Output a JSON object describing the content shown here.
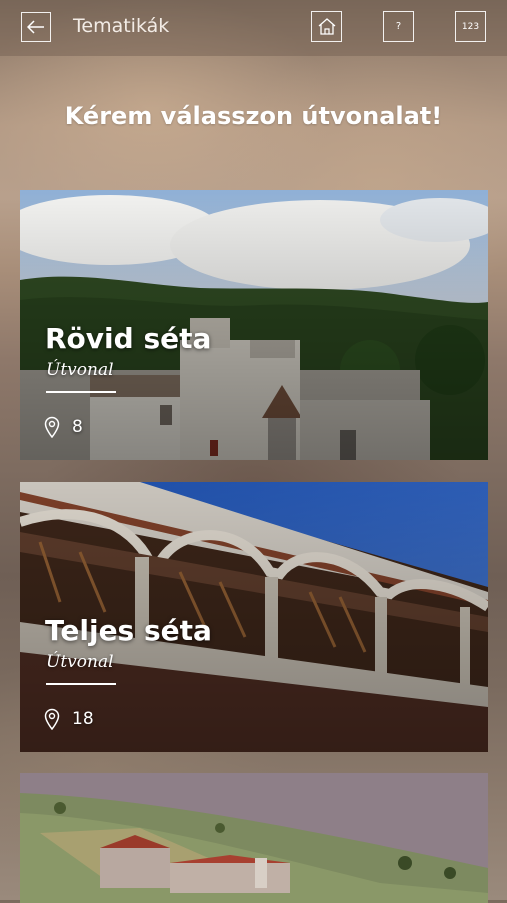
{
  "header": {
    "title": "Tematikák",
    "help_label": "?",
    "numbers_label": "123"
  },
  "main": {
    "heading": "Kérem válasszon útvonalat!",
    "routes": [
      {
        "title": "Rövid séta",
        "subtitle": "Útvonal",
        "count": "8"
      },
      {
        "title": "Teljes séta",
        "subtitle": "Útvonal",
        "count": "18"
      }
    ]
  },
  "icons": {
    "back": "arrow-left-icon",
    "home": "home-icon",
    "pin": "map-pin-icon"
  },
  "colors": {
    "text": "#ffffff",
    "header_bg": "#78645a"
  }
}
